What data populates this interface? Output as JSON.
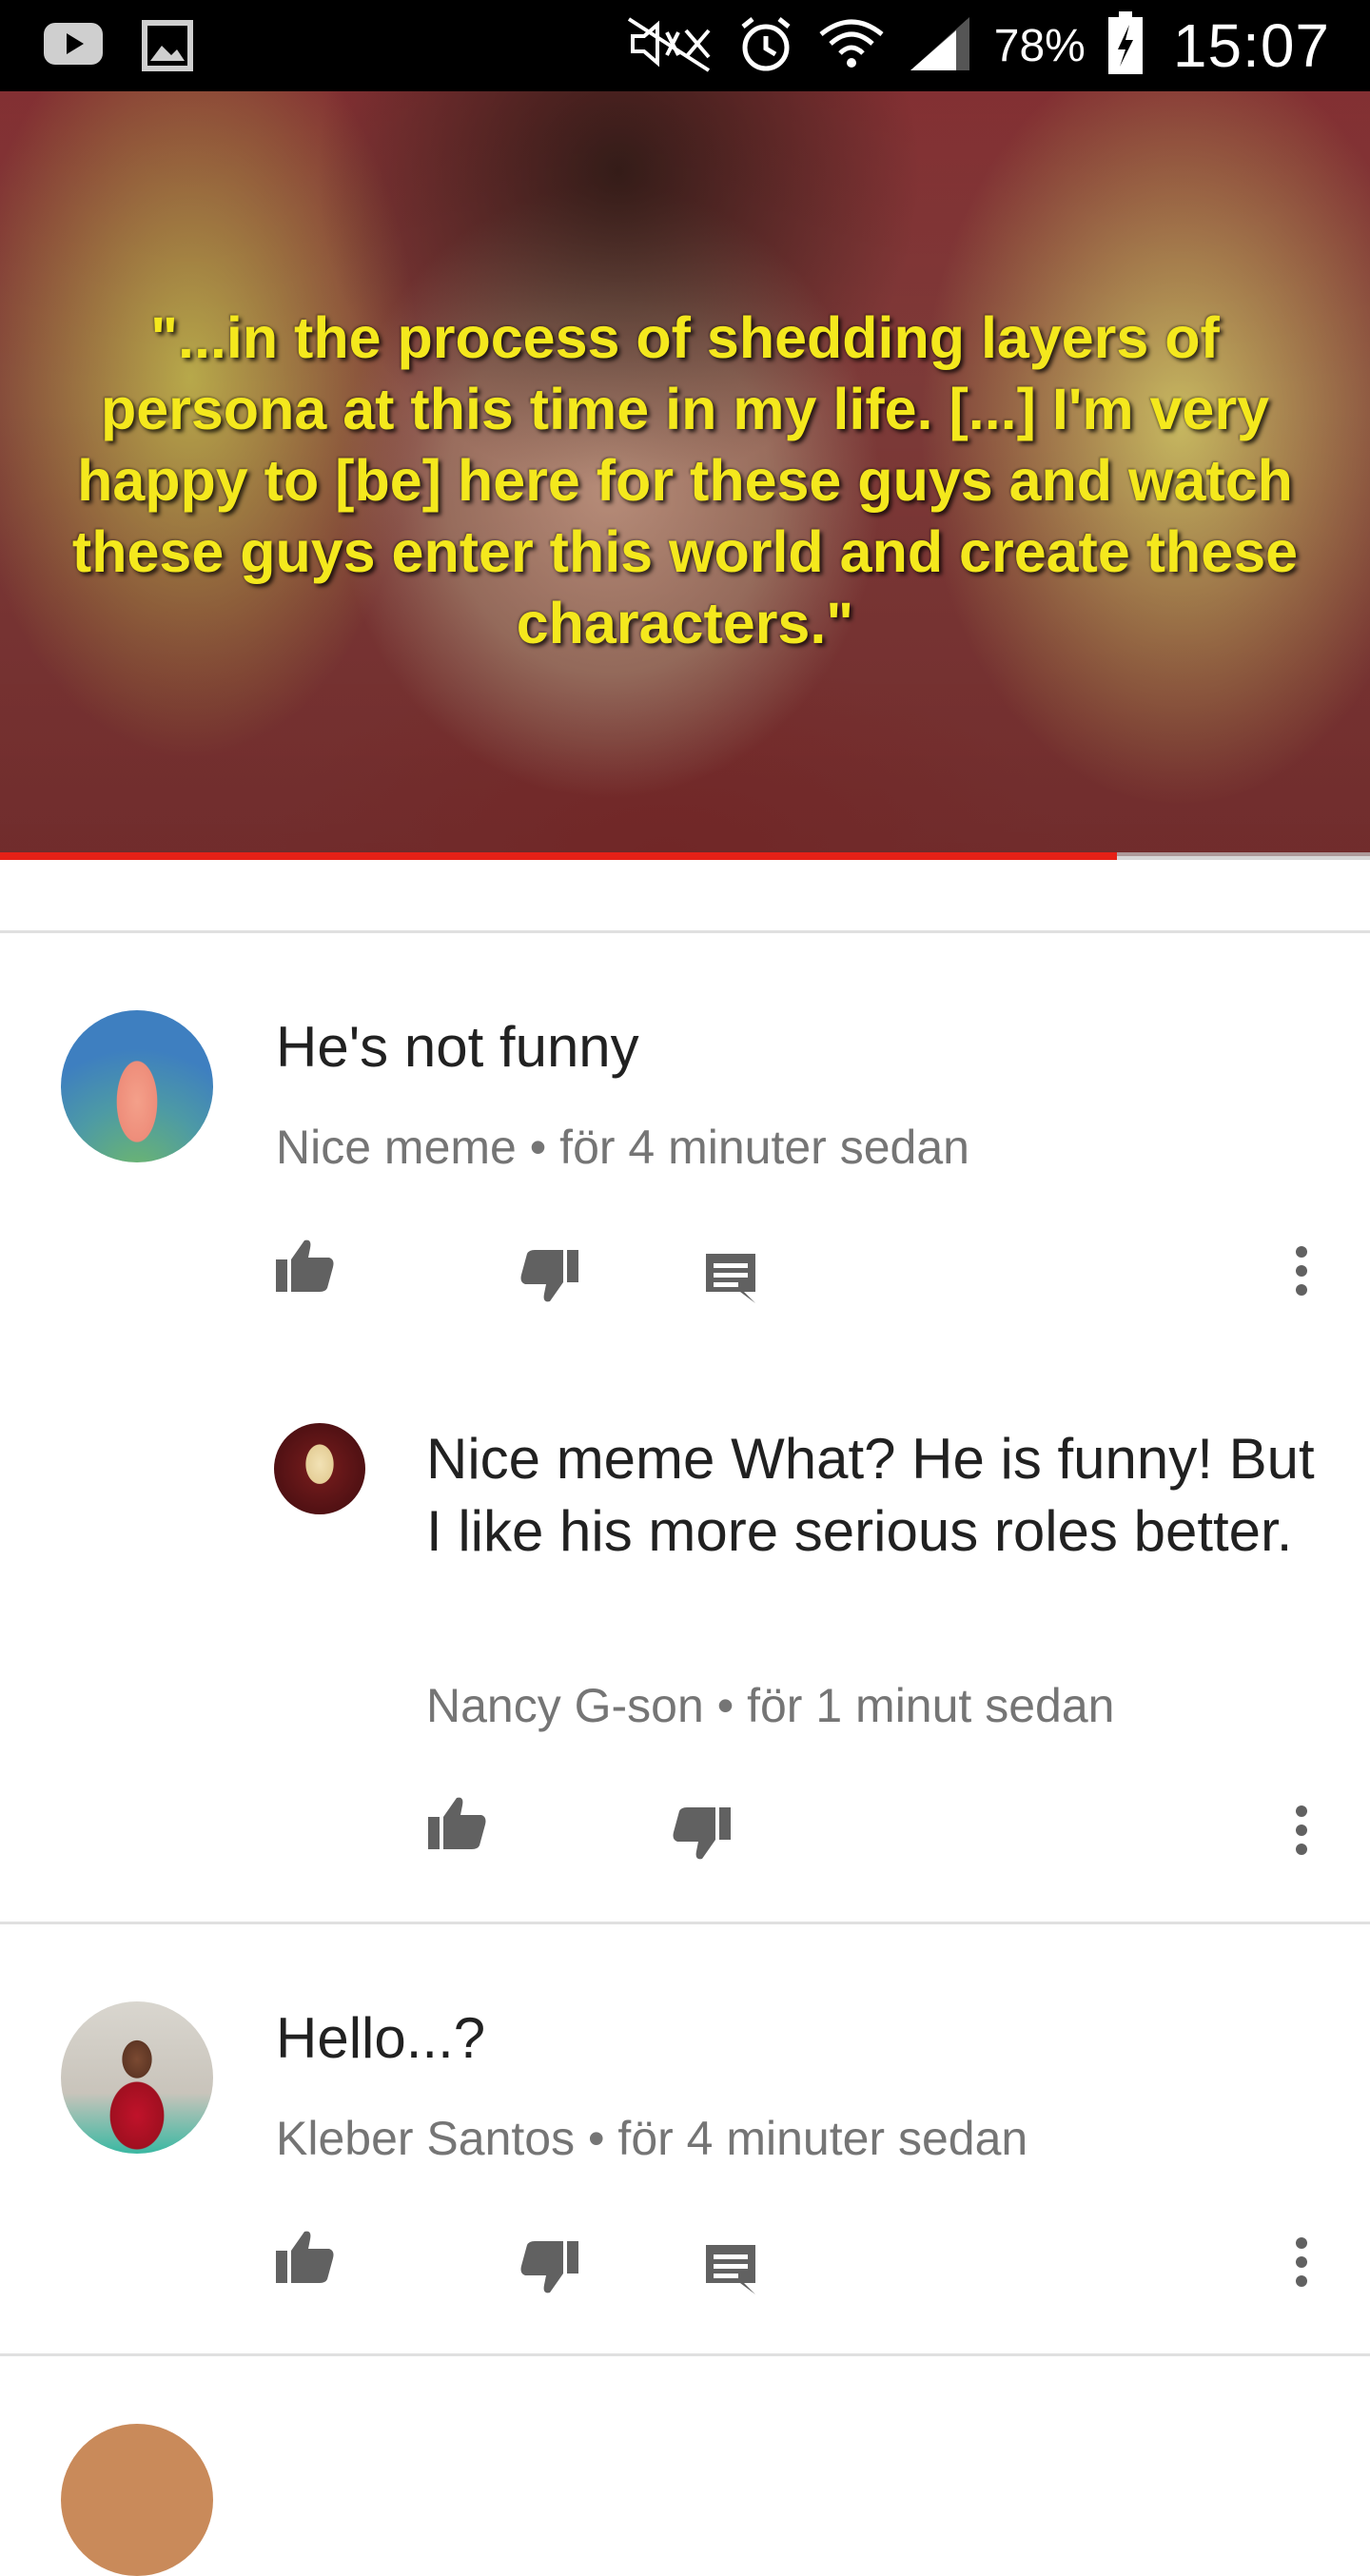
{
  "status_bar": {
    "battery": "78%",
    "time": "15:07",
    "icons": [
      "youtube-icon",
      "gallery-icon",
      "mute-icon",
      "alarm-icon",
      "wifi-icon",
      "signal-icon",
      "battery-icon"
    ]
  },
  "video": {
    "caption": "\"...in the process of shedding layers of persona at this time in my life. [...] I'm very happy to [be] here for these guys and watch these guys enter this world and create these characters.\"",
    "progress": 0.815,
    "colors": {
      "caption": "#f4e81d",
      "progress": "#e62117"
    }
  },
  "comments": [
    {
      "text": "He's not funny",
      "author": "Nice meme",
      "time": "för 4 minuter sedan",
      "avatar": "patrick-avatar"
    },
    {
      "text": "Nice meme What? He is funny! But I like his more serious roles better.",
      "author": "Nancy G-son",
      "time": "för 1 minut sedan",
      "avatar": "nancy-avatar"
    },
    {
      "text": "Hello...?",
      "author": "Kleber Santos",
      "time": "för 4 minuter sedan",
      "avatar": "kleber-avatar"
    }
  ],
  "meta_separator": "•"
}
